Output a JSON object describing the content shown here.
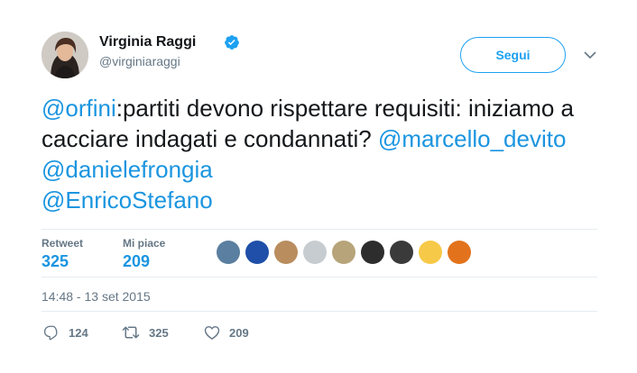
{
  "user": {
    "name": "Virginia Raggi",
    "handle": "@virginiaraggi"
  },
  "follow_label": "Segui",
  "tweet": {
    "parts": [
      {
        "text": "@orfini",
        "mention": true
      },
      {
        "text": ":partiti devono rispettare requisiti: iniziamo a cacciare indagati e condannati? ",
        "mention": false
      },
      {
        "text": "@marcello_devito",
        "mention": true
      },
      {
        "text": " ",
        "mention": false
      },
      {
        "text": "@danielefrongia",
        "mention": true
      },
      {
        "text": " ",
        "mention": false
      },
      {
        "text": "@EnricoStefano",
        "mention": true
      }
    ]
  },
  "stats": {
    "retweet_label": "Retweet",
    "retweet_count": "325",
    "likes_label": "Mi piace",
    "likes_count": "209"
  },
  "likers": [
    {
      "color": "#5a7fa0"
    },
    {
      "color": "#1f4fa8"
    },
    {
      "color": "#b98d5e"
    },
    {
      "color": "#c7ccd1"
    },
    {
      "color": "#b7a47a"
    },
    {
      "color": "#2d2d2d"
    },
    {
      "color": "#3a3a3a"
    },
    {
      "color": "#f7c948"
    },
    {
      "color": "#e2731c"
    }
  ],
  "timestamp": "14:48 - 13 set 2015",
  "actions": {
    "replies": "124",
    "retweets": "325",
    "likes": "209"
  },
  "colors": {
    "accent": "#1da1f2",
    "link": "#1b95e0",
    "muted": "#657786"
  }
}
